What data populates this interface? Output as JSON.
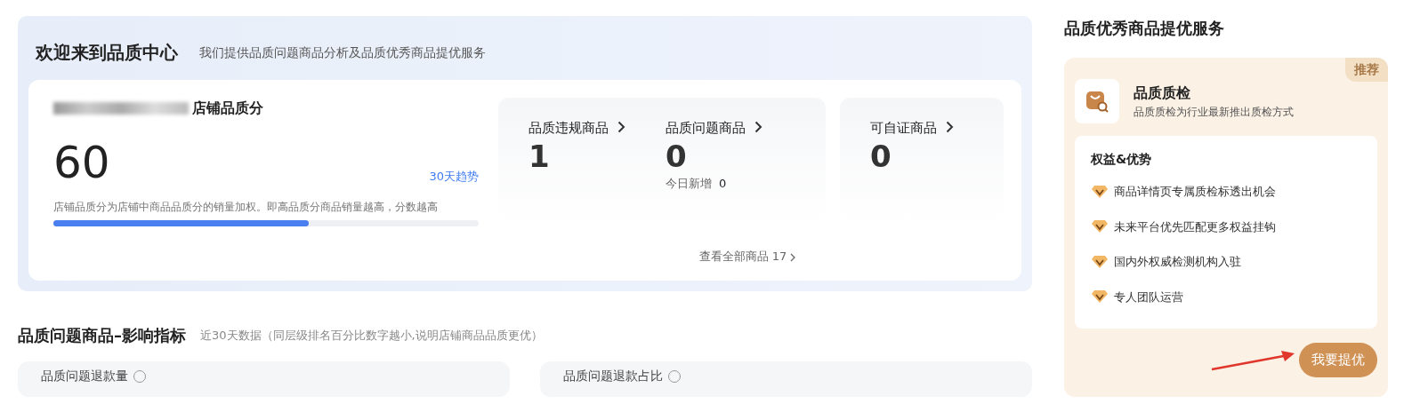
{
  "welcome": {
    "title": "欢迎来到品质中心",
    "subtitle": "我们提供品质问题商品分析及品质优秀商品提优服务"
  },
  "score": {
    "label": "店铺品质分",
    "value": "60",
    "trend_link": "30天趋势",
    "note": "店铺品质分为店铺中商品品质分的销量加权。即高品质分商品销量越高，分数越高",
    "level": 0.6
  },
  "stat_groups": [
    {
      "stats": [
        {
          "label": "品质违规商品",
          "value": "1"
        },
        {
          "label": "品质问题商品",
          "value": "0",
          "sub_label": "今日新增",
          "sub_value": "0"
        }
      ]
    },
    {
      "stats": [
        {
          "label": "可自证商品",
          "value": "0"
        }
      ]
    }
  ],
  "view_all": "查看全部商品 17",
  "impact": {
    "title": "品质问题商品–影响指标",
    "subtitle": "近30天数据（同层级排名百分比数字越小,说明店铺商品品质更优）",
    "cards": [
      {
        "title": "品质问题退款量"
      },
      {
        "title": "品质问题退款占比"
      }
    ]
  },
  "service": {
    "title": "品质优秀商品提优服务",
    "badge": "推荐",
    "name": "品质质检",
    "description": "品质质检为行业最新推出质检方式",
    "benefits_title": "权益&优势",
    "benefits": [
      "商品详情页专属质检标透出机会",
      "未来平台优先匹配更多权益挂钩",
      "国内外权威检测机构入驻",
      "专人团队运营"
    ],
    "button": "我要提优"
  }
}
